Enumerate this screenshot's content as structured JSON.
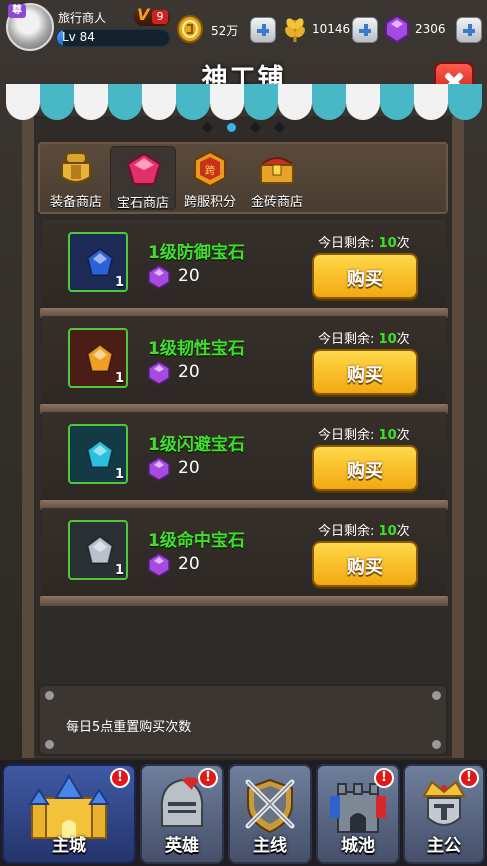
{
  "player": {
    "vip_tag": "尊",
    "name": "旅行商人",
    "vip_level": "9",
    "level_text": "Lv 84",
    "level_progress": 0.05
  },
  "resources": {
    "gold": {
      "value": "52万",
      "icon": "gold-coin-icon"
    },
    "wheat": {
      "value": "10146",
      "icon": "wheat-icon"
    },
    "gem": {
      "value": "2306",
      "icon": "purple-gem-icon"
    }
  },
  "title": "神工铺",
  "pager": {
    "count": 4,
    "active": 1
  },
  "tabs": [
    {
      "label": "装备商店",
      "icon": "armor-icon",
      "active": false
    },
    {
      "label": "宝石商店",
      "icon": "red-gem-icon",
      "active": true
    },
    {
      "label": "跨服积分",
      "icon": "cross-server-medal-icon",
      "active": false
    },
    {
      "label": "金砖商店",
      "icon": "treasure-chest-icon",
      "active": false
    }
  ],
  "items": [
    {
      "name": "1级防御宝石",
      "count": "1",
      "price": "20",
      "remain_label": "今日剩余:",
      "remain_count": "10",
      "remain_unit": "次",
      "buy": "购买",
      "gem_color": "#2a60d8",
      "box_bg": "#1c2a55"
    },
    {
      "name": "1级韧性宝石",
      "count": "1",
      "price": "20",
      "remain_label": "今日剩余:",
      "remain_count": "10",
      "remain_unit": "次",
      "buy": "购买",
      "gem_color": "#f0a020",
      "box_bg": "#4a1e14"
    },
    {
      "name": "1级闪避宝石",
      "count": "1",
      "price": "20",
      "remain_label": "今日剩余:",
      "remain_count": "10",
      "remain_unit": "次",
      "buy": "购买",
      "gem_color": "#2bbfe0",
      "box_bg": "#133a45"
    },
    {
      "name": "1级命中宝石",
      "count": "1",
      "price": "20",
      "remain_label": "今日剩余:",
      "remain_count": "10",
      "remain_unit": "次",
      "buy": "购买",
      "gem_color": "#b9c2cc",
      "box_bg": "#2b3035"
    }
  ],
  "notice": "每日5点重置购买次数",
  "nav": [
    {
      "label": "主城",
      "badge": "!",
      "icon": "castle-icon",
      "active": true
    },
    {
      "label": "英雄",
      "badge": "!",
      "icon": "knight-helmet-icon",
      "active": false
    },
    {
      "label": "主线",
      "badge": "",
      "icon": "crossed-swords-shield-icon",
      "active": false
    },
    {
      "label": "城池",
      "badge": "!",
      "icon": "fortress-icon",
      "active": false
    },
    {
      "label": "主公",
      "badge": "!",
      "icon": "crowned-lord-icon",
      "active": false
    }
  ],
  "colors": {
    "accent_green": "#3fe02a",
    "buy_button": "#f2a912",
    "awning_teal": "#49b8c6",
    "close_red": "#d8281e"
  }
}
